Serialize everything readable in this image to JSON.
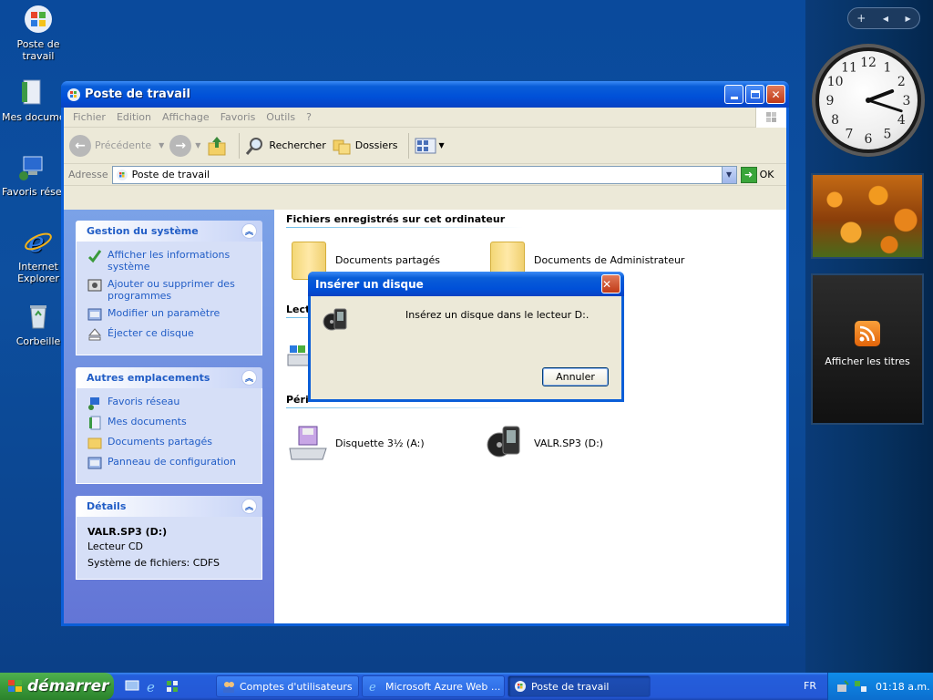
{
  "desktop": {
    "icons": [
      {
        "label": "Poste de travail"
      },
      {
        "label": "Mes documents"
      },
      {
        "label": "Favoris réseau"
      },
      {
        "label": "Internet Explorer"
      },
      {
        "label": "Corbeille"
      }
    ]
  },
  "sidebar": {
    "top_plus": "+",
    "top_prev": "◀",
    "top_next": "▶",
    "clock": {
      "hour": 2,
      "minute": 18,
      "numbers": [
        "12",
        "1",
        "2",
        "3",
        "4",
        "5",
        "6",
        "7",
        "8",
        "9",
        "10",
        "11"
      ]
    },
    "feed_label": "Afficher les titres"
  },
  "window": {
    "title": "Poste de travail",
    "menu": [
      "Fichier",
      "Edition",
      "Affichage",
      "Favoris",
      "Outils",
      "?"
    ],
    "toolbar": {
      "back": "Précédente",
      "search": "Rechercher",
      "folders": "Dossiers"
    },
    "address": {
      "label": "Adresse",
      "value": "Poste de travail",
      "go": "OK"
    },
    "panels": {
      "system": {
        "title": "Gestion du système",
        "tasks": [
          "Afficher les informations système",
          "Ajouter ou supprimer des programmes",
          "Modifier un paramètre",
          "Éjecter ce disque"
        ]
      },
      "places": {
        "title": "Autres emplacements",
        "tasks": [
          "Favoris réseau",
          "Mes documents",
          "Documents partagés",
          "Panneau de configuration"
        ]
      },
      "details": {
        "title": "Détails",
        "name": "VALR.SP3 (D:)",
        "type": "Lecteur CD",
        "fs": "Système de fichiers: CDFS"
      }
    },
    "groups": {
      "stored": "Fichiers enregistrés sur cet ordinateur",
      "drives_partial": "Lect",
      "devices_partial": "Péri"
    },
    "items": {
      "shared_docs": "Documents partagés",
      "admin_docs": "Documents de Administrateur",
      "floppy": "Disquette 3½ (A:)",
      "cd": "VALR.SP3 (D:)"
    }
  },
  "dialog": {
    "title": "Insérer un disque",
    "message": "Insérez un disque dans le lecteur D:.",
    "cancel": "Annuler"
  },
  "taskbar": {
    "start": "démarrer",
    "tasks": [
      "Comptes d'utilisateurs",
      "Microsoft Azure Web ...",
      "Poste de travail"
    ],
    "lang": "FR",
    "time": "01:18 a.m."
  },
  "colors": {
    "accent": "#0a5ed8",
    "link": "#215dc6",
    "taskpane": "#6375d6"
  }
}
